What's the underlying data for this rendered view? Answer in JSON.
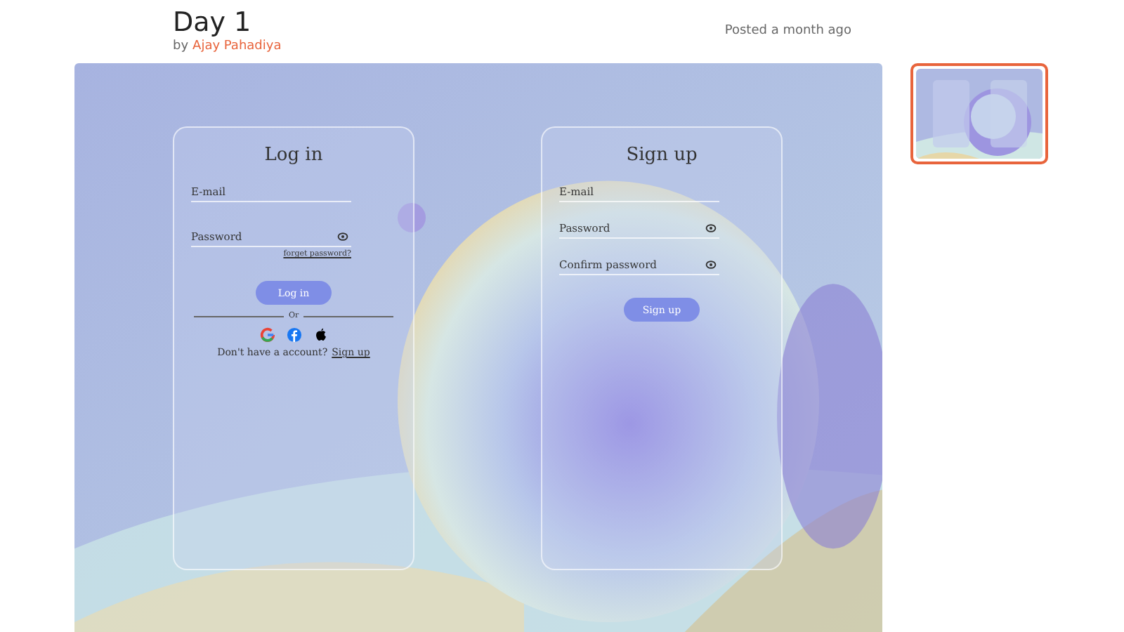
{
  "post": {
    "title": "Day 1",
    "by": "by",
    "author": "Ajay Pahadiya",
    "posted": "Posted a month ago"
  },
  "login": {
    "title": "Log in",
    "fields": [
      {
        "placeholder": "E-mail",
        "kind": "text"
      },
      {
        "placeholder": "Password",
        "kind": "password"
      }
    ],
    "forgot": "forget password?",
    "button": "Log in",
    "divider": "Or",
    "prompt": "Don't have a account?",
    "link": "Sign up"
  },
  "signup": {
    "title": "Sign up",
    "fields": [
      {
        "placeholder": "E-mail",
        "kind": "text"
      },
      {
        "placeholder": "Password",
        "kind": "password"
      },
      {
        "placeholder": "Confirm password",
        "kind": "password"
      }
    ],
    "button": "Sign up"
  },
  "thumbnails": [
    {
      "kind": "picture",
      "selected": true
    }
  ]
}
